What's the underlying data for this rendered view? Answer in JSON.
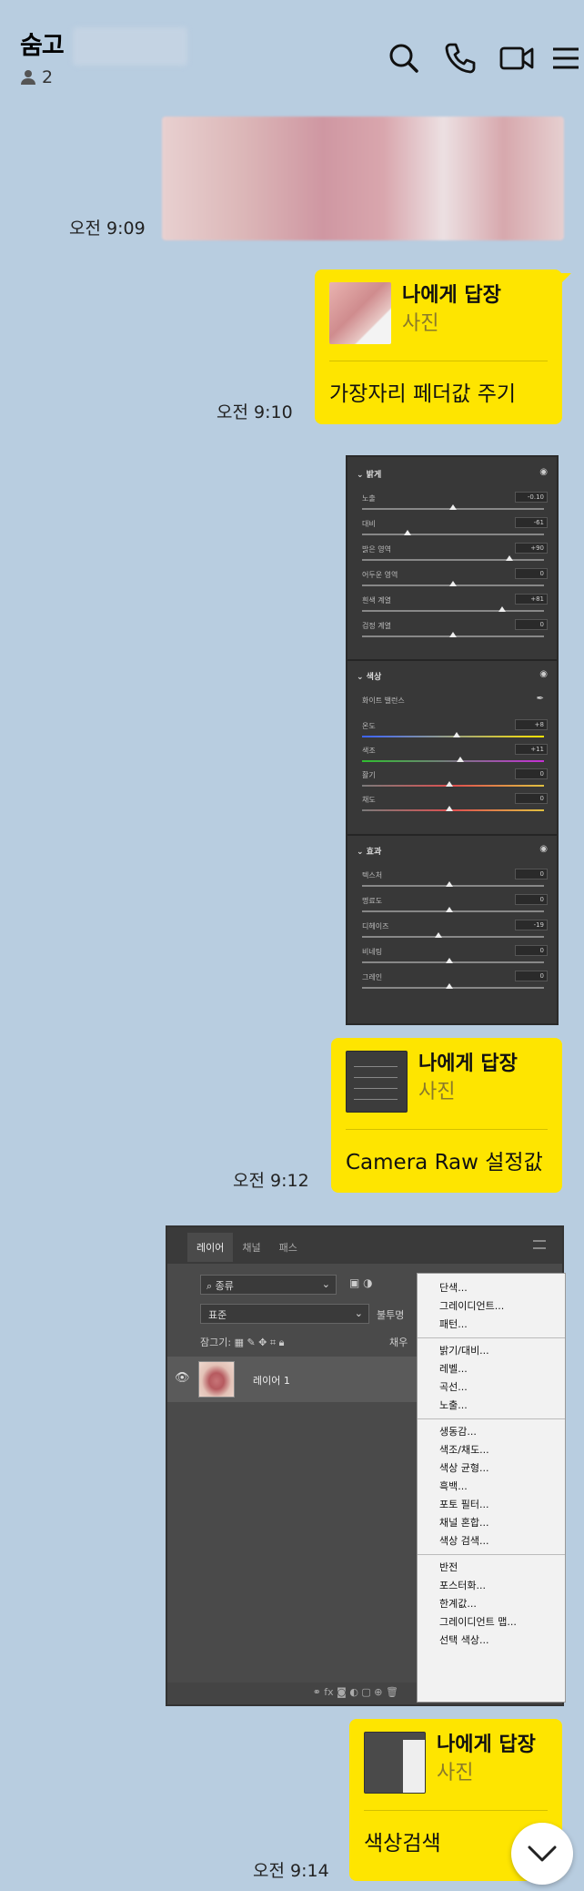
{
  "header": {
    "title": "숨고",
    "member_count": "2"
  },
  "messages": [
    {
      "time": "오전 9:09"
    },
    {
      "time": "오전 9:10",
      "reply_title": "나에게 답장",
      "reply_sub": "사진",
      "text": "가장자리 페더값 주기"
    },
    {
      "time": "오전 9:12",
      "reply_title": "나에게 답장",
      "reply_sub": "사진",
      "text": "Camera Raw 설정값"
    },
    {
      "time": "오전 9:14",
      "reply_title": "나에게 답장",
      "reply_sub": "사진",
      "text": "색상검색"
    }
  ],
  "camera_raw": {
    "sections": [
      {
        "name": "밝게",
        "sliders": [
          {
            "label": "노출",
            "value": "-0.10"
          },
          {
            "label": "대비",
            "value": "-61"
          },
          {
            "label": "밝은 영역",
            "value": "+90"
          },
          {
            "label": "어두운 영역",
            "value": "0"
          },
          {
            "label": "흰색 계열",
            "value": "+81"
          },
          {
            "label": "검정 계열",
            "value": "0"
          }
        ]
      },
      {
        "name": "색상",
        "sub": "화이트 밸런스",
        "sliders": [
          {
            "label": "온도",
            "value": "+8"
          },
          {
            "label": "색조",
            "value": "+11"
          },
          {
            "label": "활기",
            "value": "0"
          },
          {
            "label": "채도",
            "value": "0"
          }
        ]
      },
      {
        "name": "효과",
        "sliders": [
          {
            "label": "텍스처",
            "value": "0"
          },
          {
            "label": "명료도",
            "value": "0"
          },
          {
            "label": "디헤이즈",
            "value": "-19"
          },
          {
            "label": "비네팅",
            "value": "0"
          },
          {
            "label": "그레인",
            "value": "0"
          }
        ]
      }
    ]
  },
  "layers_panel": {
    "tabs": [
      "레이어",
      "채널",
      "패스"
    ],
    "kind_label": "종류",
    "blend_mode": "표준",
    "opacity_label": "불투명",
    "lock_label": "잠그기:",
    "fill_label": "채우",
    "layer_name": "레이어 1",
    "menu_groups": [
      [
        "단색...",
        "그레이디언트...",
        "패턴..."
      ],
      [
        "밝기/대비...",
        "레벨...",
        "곡선...",
        "노출..."
      ],
      [
        "생동감...",
        "색조/채도...",
        "색상 균형...",
        "흑백...",
        "포토 필터...",
        "채널 혼합...",
        "색상 검색..."
      ],
      [
        "반전",
        "포스터화...",
        "한계값...",
        "그레이디언트 맵...",
        "선택 색상..."
      ]
    ]
  },
  "colors": {
    "background": "#b8cde0",
    "bubble": "#fee500"
  }
}
